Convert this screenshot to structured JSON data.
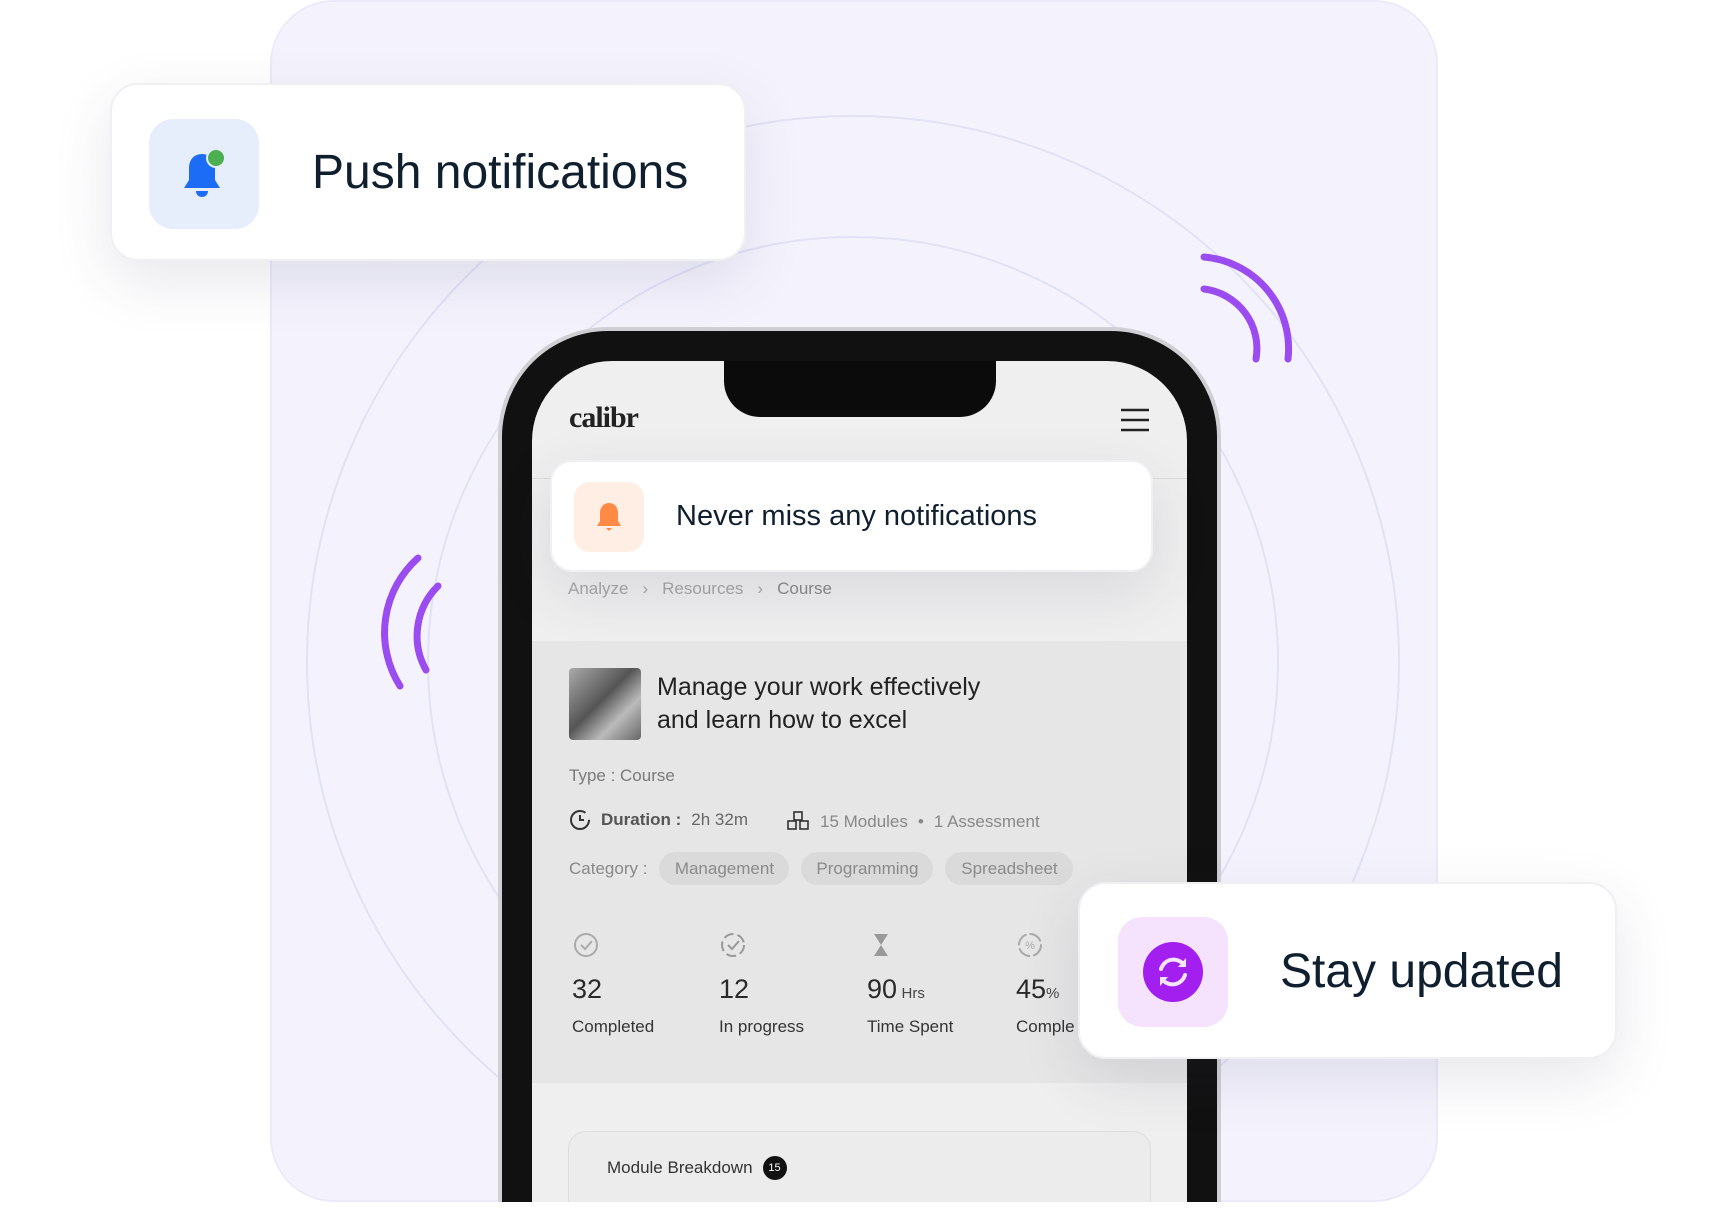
{
  "push_card": {
    "title": "Push notifications",
    "icon": "bell-icon",
    "accent": "#1d6cf5",
    "dot": "#4caf50"
  },
  "stay_card": {
    "title": "Stay updated",
    "icon": "refresh-icon",
    "accent": "#a21ff0"
  },
  "phone": {
    "logo": "calibr",
    "menu_icon": "hamburger-icon",
    "toast": {
      "text": "Never miss any notifications",
      "icon": "bell-icon",
      "accent": "#ff8a45"
    },
    "breadcrumb": [
      "Analyze",
      "Resources",
      "Course"
    ],
    "course": {
      "title_line1": "Manage your work effectively",
      "title_line2": "and learn how to excel",
      "type": "Type : Course",
      "duration_label": "Duration :",
      "duration_value": "2h 32m",
      "modules": "15 Modules",
      "assessment": "1 Assessment",
      "category_label": "Category :",
      "categories": [
        "Management",
        "Programming",
        "Spreadsheet"
      ]
    },
    "stats": [
      {
        "value": "32",
        "unit": "",
        "label": "Completed",
        "icon": "check-circle-icon"
      },
      {
        "value": "12",
        "unit": "",
        "label": "In progress",
        "icon": "dashed-check-circle-icon"
      },
      {
        "value": "90",
        "unit": "Hrs",
        "label": "Time Spent",
        "icon": "hourglass-icon"
      },
      {
        "value": "45",
        "unit": "%",
        "label": "Comple",
        "icon": "percent-circle-icon"
      }
    ],
    "module_breakdown": {
      "title": "Module Breakdown",
      "count": "15"
    }
  }
}
